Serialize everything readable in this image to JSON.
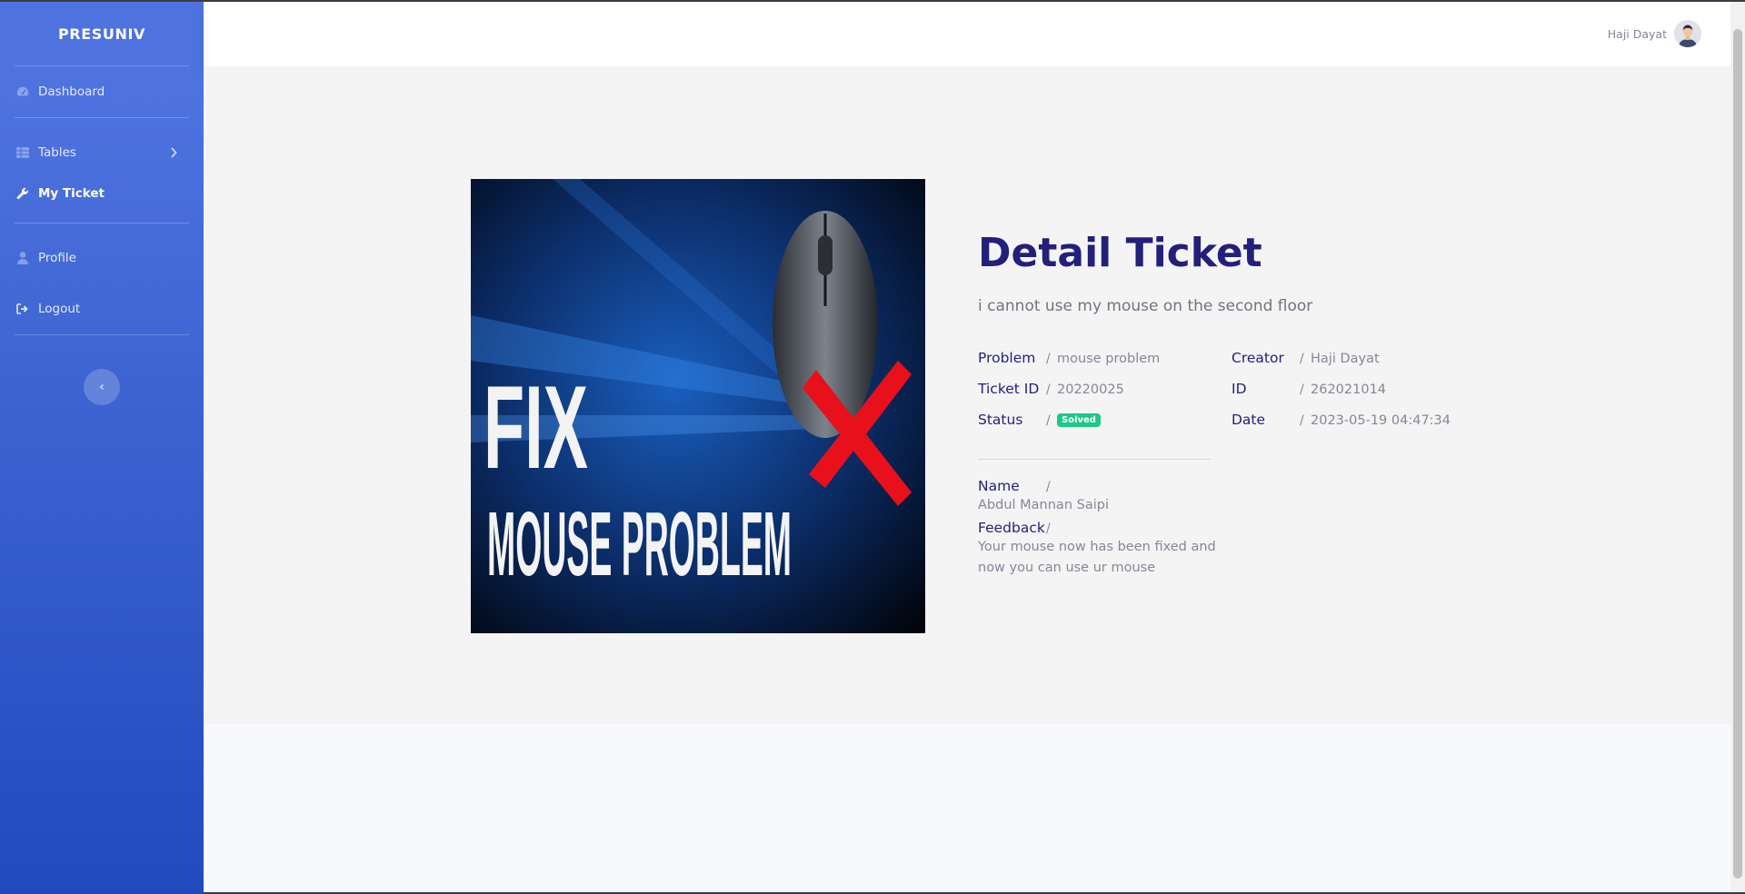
{
  "sidebar": {
    "brand": "PRESUNIV",
    "items": [
      {
        "label": "Dashboard",
        "icon": "dashboard-icon"
      },
      {
        "label": "Tables",
        "icon": "table-icon"
      },
      {
        "label": "My Ticket",
        "icon": "wrench-icon"
      },
      {
        "label": "Profile",
        "icon": "user-icon"
      },
      {
        "label": "Logout",
        "icon": "logout-icon"
      }
    ],
    "toggle_glyph": "‹"
  },
  "topbar": {
    "user_name": "Haji Dayat"
  },
  "ticket": {
    "image_text_1": "FIX",
    "image_text_2": "MOUSE PROBLEM",
    "title": "Detail Ticket",
    "description": "i cannot use my mouse on the second floor",
    "fields": {
      "problem_label": "Problem",
      "problem_value": "mouse problem",
      "ticket_id_label": "Ticket ID",
      "ticket_id_value": "20220025",
      "status_label": "Status",
      "status_value": "Solved",
      "creator_label": "Creator",
      "creator_value": "Haji Dayat",
      "id_label": "ID",
      "id_value": "262021014",
      "date_label": "Date",
      "date_value": "2023-05-19 04:47:34"
    },
    "separator": "/",
    "handler": {
      "name_label": "Name",
      "name_value": "Abdul Mannan Saipi",
      "feedback_label": "Feedback",
      "feedback_value": "Your mouse now has been fixed and now you can use ur mouse"
    }
  },
  "colors": {
    "sidebar_top": "#4e73df",
    "sidebar_bottom": "#224abe",
    "title": "#231f7a",
    "badge_success": "#1cc88a"
  }
}
